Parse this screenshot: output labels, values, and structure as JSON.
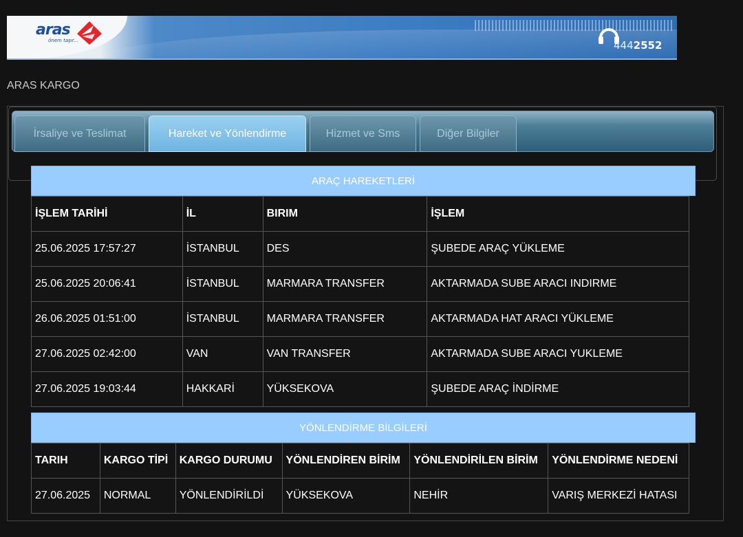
{
  "header": {
    "logo_text": "aras",
    "logo_tagline": "önem taşır...",
    "phone_prefix": "444",
    "phone_suffix": "2552",
    "site_title": "ARAS KARGO"
  },
  "tabs": [
    {
      "label": "İrsaliye ve Teslimat",
      "active": false
    },
    {
      "label": "Hareket ve Yönlendirme",
      "active": true
    },
    {
      "label": "Hizmet ve Sms",
      "active": false
    },
    {
      "label": "Diğer Bilgiler",
      "active": false
    }
  ],
  "vehicle_movements": {
    "title": "ARAÇ HAREKETLERİ",
    "columns": [
      "İŞLEM TARİHİ",
      "İL",
      "BIRIM",
      "İŞLEM"
    ],
    "rows": [
      [
        "25.06.2025 17:57:27",
        "İSTANBUL",
        "DES",
        "ŞUBEDE ARAÇ YÜKLEME"
      ],
      [
        "25.06.2025 20:06:41",
        "İSTANBUL",
        "MARMARA TRANSFER",
        "AKTARMADA SUBE ARACI INDIRME"
      ],
      [
        "26.06.2025 01:51:00",
        "İSTANBUL",
        "MARMARA TRANSFER",
        "AKTARMADA HAT ARACI YÜKLEME"
      ],
      [
        "27.06.2025 02:42:00",
        "VAN",
        "VAN TRANSFER",
        "AKTARMADA SUBE ARACI YUKLEME"
      ],
      [
        "27.06.2025 19:03:44",
        "HAKKARİ",
        "YÜKSEKOVA",
        "ŞUBEDE ARAÇ İNDİRME"
      ]
    ]
  },
  "redirect_info": {
    "title": "YÖNLENDİRME BİLGİLERİ",
    "columns": [
      "TARIH",
      "KARGO TİPİ",
      "KARGO DURUMU",
      "YÖNLENDİREN BİRİM",
      "YÖNLENDİRİLEN BİRİM",
      "YÖNLENDİRME NEDENİ"
    ],
    "rows": [
      [
        "27.06.2025",
        "NORMAL",
        "YÖNLENDİRİLDİ",
        "YÜKSEKOVA",
        "NEHİR",
        "VARIŞ MERKEZİ HATASI"
      ]
    ]
  },
  "colors": {
    "section_header": "#99ccff",
    "active_tab": "#7fc0ea",
    "brand_red": "#e3262e",
    "brand_blue": "#1f4f99"
  }
}
